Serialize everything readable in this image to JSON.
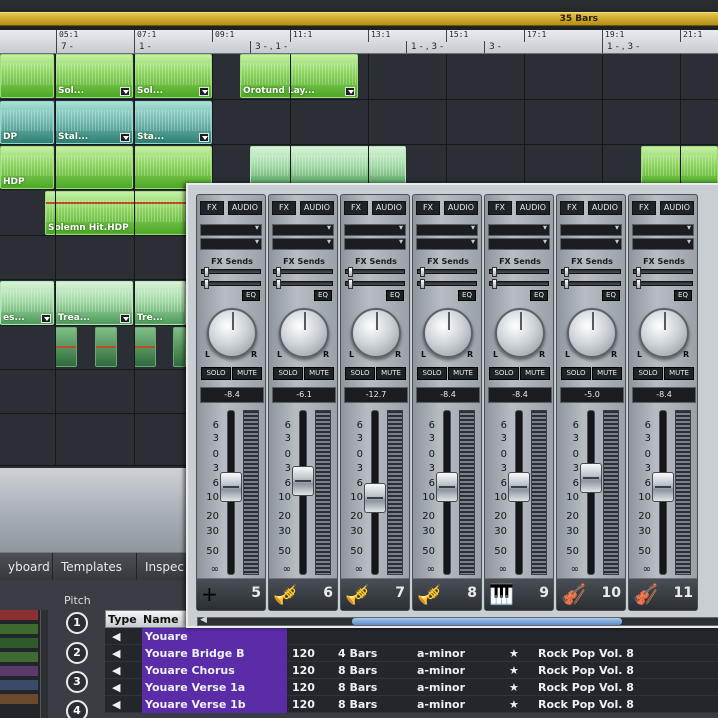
{
  "song_length": "35 Bars",
  "ruler": {
    "bars": [
      "05:1",
      "07:1",
      "09:1",
      "11:1",
      "13:1",
      "15:1",
      "17:1",
      "19:1",
      "21:1"
    ],
    "markers": [
      "7 -",
      "1 -",
      "3 - , 1 -",
      "1 - , 3 -",
      "3 -",
      "1 - , 3 -"
    ]
  },
  "clips": [
    "Sol...",
    "Sol...",
    "Orotund Lay...",
    "DP",
    "Stal...",
    "Sta...",
    "HDP",
    "Solemn Hit.HDP",
    "es...",
    "Trea...",
    "Tre..."
  ],
  "tabs": [
    "yboard",
    "Templates",
    "Inspec"
  ],
  "library": {
    "pitch_label": "Pitch",
    "pitch_buttons": [
      "1",
      "2",
      "3",
      "4"
    ],
    "columns": [
      "Type",
      "Name"
    ],
    "rows": [
      {
        "name": "Youare",
        "bpm": "",
        "length": "",
        "key": "",
        "style": ""
      },
      {
        "name": "Youare Bridge B",
        "bpm": "120",
        "length": "4 Bars",
        "key": "a-minor",
        "style": "Rock Pop Vol. 8"
      },
      {
        "name": "Youare Chorus",
        "bpm": "120",
        "length": "8 Bars",
        "key": "a-minor",
        "style": "Rock Pop Vol. 8"
      },
      {
        "name": "Youare Verse 1a",
        "bpm": "120",
        "length": "8 Bars",
        "key": "a-minor",
        "style": "Rock Pop Vol. 8"
      },
      {
        "name": "Youare Verse 1b",
        "bpm": "120",
        "length": "8 Bars",
        "key": "a-minor",
        "style": "Rock Pop Vol. 8"
      }
    ]
  },
  "mixer": {
    "fx_label": "FX",
    "audio_label": "AUDIO",
    "sends_label": "FX Sends",
    "eq_label": "EQ",
    "left_label": "L",
    "right_label": "R",
    "solo_label": "SOLO",
    "mute_label": "MUTE",
    "scale": [
      "6",
      "3",
      "0",
      "3",
      "6",
      "10",
      "20",
      "30",
      "50",
      "∞"
    ],
    "channels": [
      {
        "number": "5",
        "volume": "-8.4",
        "level_db": -8.4,
        "instrument": "add"
      },
      {
        "number": "6",
        "volume": "-6.1",
        "level_db": -6.1,
        "instrument": "trumpet"
      },
      {
        "number": "7",
        "volume": "-12.7",
        "level_db": -12.7,
        "instrument": "trumpet"
      },
      {
        "number": "8",
        "volume": "-8.4",
        "level_db": -8.4,
        "instrument": "trumpet"
      },
      {
        "number": "9",
        "volume": "-8.4",
        "level_db": -8.4,
        "instrument": "piano"
      },
      {
        "number": "10",
        "volume": "-5.0",
        "level_db": -5.0,
        "instrument": "violin"
      },
      {
        "number": "11",
        "volume": "-8.4",
        "level_db": -8.4,
        "instrument": "violin"
      }
    ]
  }
}
